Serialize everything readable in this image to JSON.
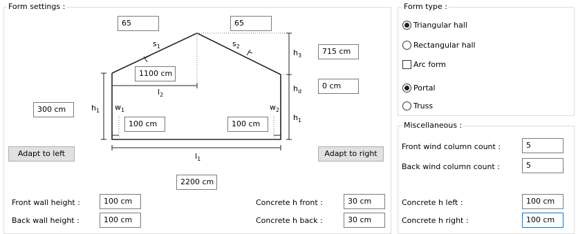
{
  "form_settings": {
    "title": "Form settings :",
    "left_roof_angle": "65",
    "right_roof_angle": "65",
    "s1_length": "1100 cm",
    "h3_height": "715 cm",
    "hd_height": "0 cm",
    "h1_height": "300 cm",
    "w1_width": "100 cm",
    "w2_width": "100 cm",
    "l1_length": "2200 cm",
    "adapt_left_label": "Adapt to left",
    "adapt_right_label": "Adapt to right",
    "front_wall_height_label": "Front wall height :",
    "front_wall_height": "100 cm",
    "back_wall_height_label": "Back wall height :",
    "back_wall_height": "100 cm",
    "concrete_h_front_label": "Concrete h front :",
    "concrete_h_front": "30 cm",
    "concrete_h_back_label": "Concrete h back :",
    "concrete_h_back": "30 cm",
    "diagram_labels": {
      "s": "s",
      "s1": "1",
      "s2": "2",
      "h": "h",
      "h1": "1",
      "h3": "3",
      "hd": "d",
      "l": "l",
      "l1": "1",
      "l2": "2",
      "w": "w",
      "w1": "1",
      "w2": "2"
    }
  },
  "form_type": {
    "title": "Form type :",
    "triangular_hall": "Triangular hall",
    "rectangular_hall": "Rectangular hall",
    "arc_form": "Arc form",
    "portal": "Portal",
    "truss": "Truss",
    "selected_shape": "Triangular hall",
    "selected_structure": "Portal",
    "arc_form_checked": false
  },
  "miscellaneous": {
    "title": "Miscellaneous :",
    "front_wind_label": "Front wind column count :",
    "front_wind_value": "5",
    "back_wind_label": "Back wind column count :",
    "back_wind_value": "5",
    "concrete_h_left_label": "Concrete h left :",
    "concrete_h_left": "100 cm",
    "concrete_h_right_label": "Concrete h right :",
    "concrete_h_right": "100 cm"
  }
}
